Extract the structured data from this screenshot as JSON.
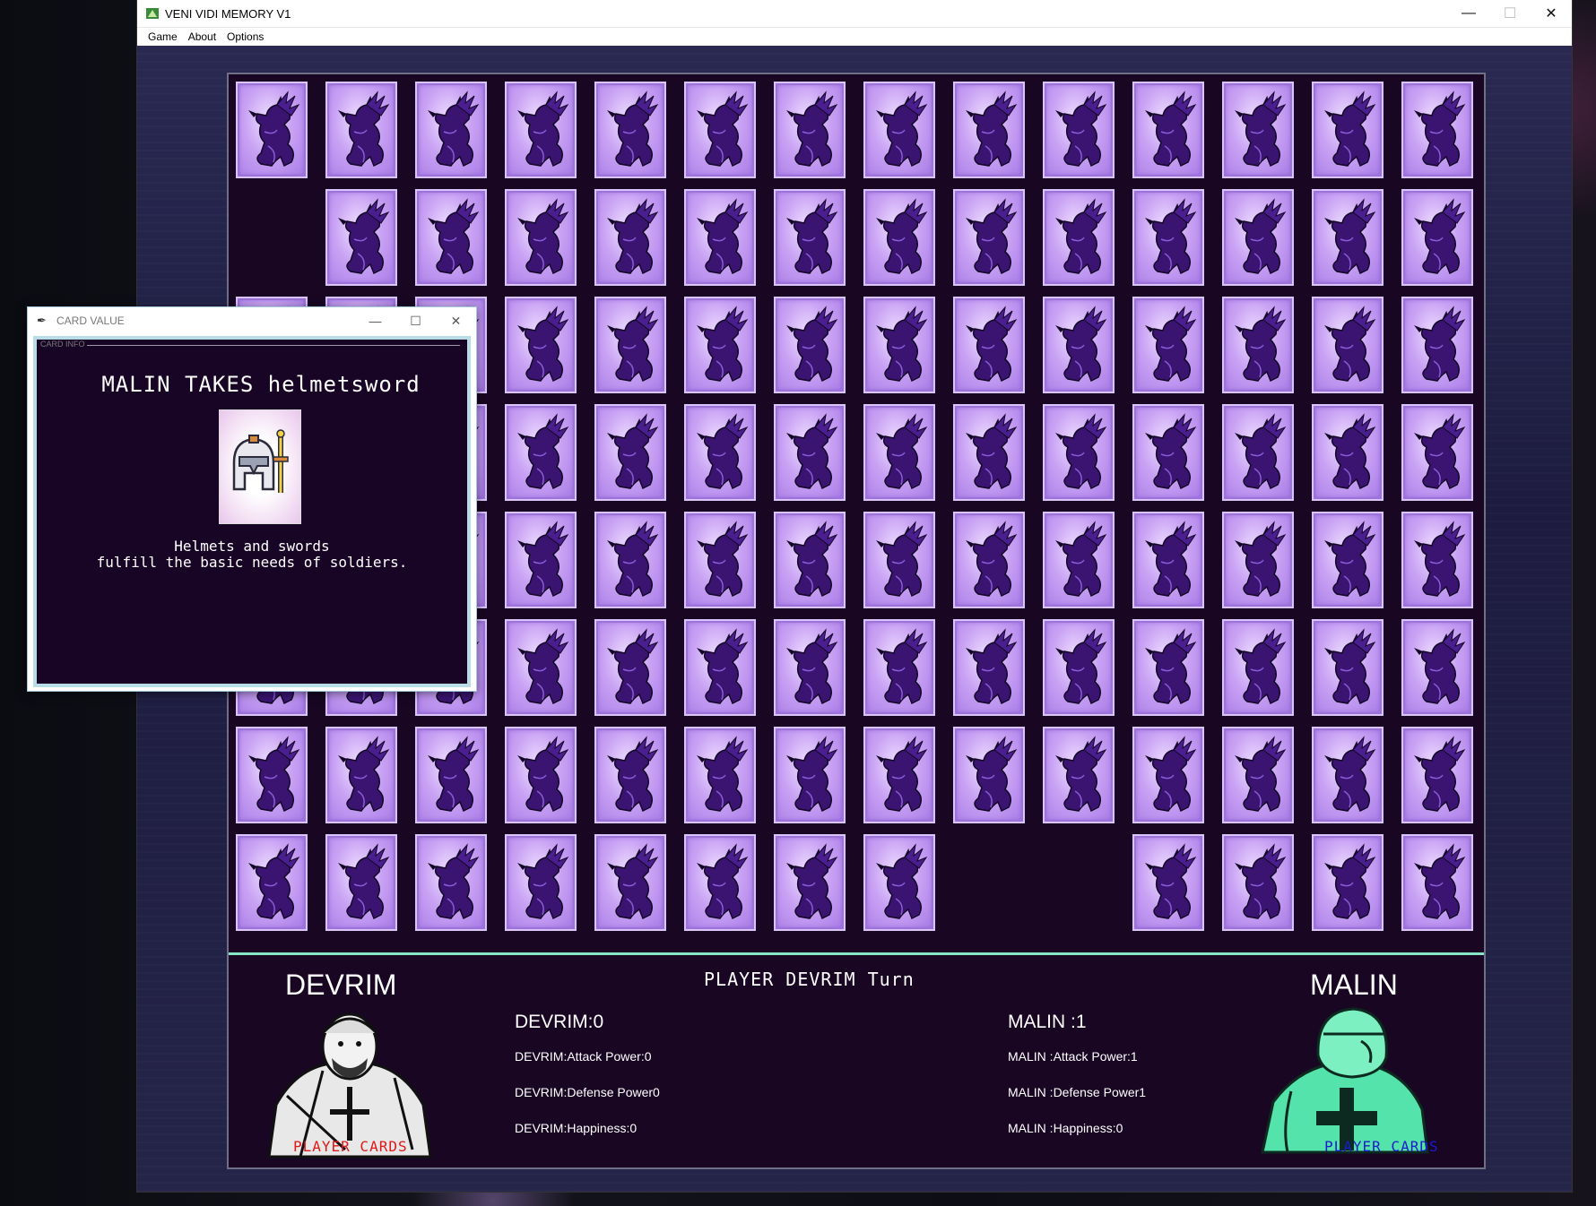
{
  "window": {
    "title": "VENI VIDI MEMORY V1",
    "controls": {
      "minimize": "—",
      "maximize": "☐",
      "close": "✕"
    }
  },
  "menu": {
    "items": [
      "Game",
      "About",
      "Options"
    ]
  },
  "board": {
    "rows": [
      [
        1,
        1,
        1,
        1,
        1,
        1,
        1,
        1,
        1,
        1,
        1,
        1,
        1,
        1
      ],
      [
        0,
        1,
        1,
        1,
        1,
        1,
        1,
        1,
        1,
        1,
        1,
        1,
        1,
        1
      ],
      [
        1,
        1,
        1,
        1,
        1,
        1,
        1,
        1,
        1,
        1,
        1,
        1,
        1,
        1
      ],
      [
        1,
        1,
        1,
        1,
        1,
        1,
        1,
        1,
        1,
        1,
        1,
        1,
        1,
        1
      ],
      [
        1,
        1,
        1,
        1,
        1,
        1,
        1,
        1,
        1,
        1,
        1,
        1,
        1,
        1
      ],
      [
        1,
        1,
        1,
        1,
        1,
        1,
        1,
        1,
        1,
        1,
        1,
        1,
        1,
        1
      ],
      [
        1,
        1,
        1,
        1,
        1,
        1,
        1,
        1,
        1,
        1,
        1,
        1,
        1,
        1
      ],
      [
        1,
        1,
        1,
        1,
        1,
        1,
        1,
        1,
        0,
        0,
        1,
        1,
        1,
        1
      ]
    ],
    "card_back_icon": "dragon-icon"
  },
  "info": {
    "turn": "PLAYER DEVRIM Turn",
    "player_left": {
      "name": "DEVRIM",
      "score": "DEVRIM:0",
      "attack": "DEVRIM:Attack Power:0",
      "defense": "DEVRIM:Defense Power0",
      "happiness": "DEVRIM:Happiness:0",
      "cards_label": "PLAYER CARDS",
      "label_color": "#e01818"
    },
    "player_right": {
      "name": "MALIN",
      "score": "MALIN :1",
      "attack": "MALIN :Attack Power:1",
      "defense": "MALIN :Defense Power1",
      "happiness": "MALIN :Happiness:0",
      "cards_label": "PLAYER CARDS",
      "label_color": "#1b1bcf"
    }
  },
  "dialog": {
    "title": "CARD VALUE",
    "frame_tag": "CARD INFO",
    "heading": "MALIN  TAKES helmetsword",
    "card_icon": "helmet-sword-icon",
    "description": "Helmets and swords\nfulfill the basic needs of soldiers."
  },
  "colors": {
    "board_bg": "#180623",
    "divider": "#86e4c7",
    "card_purple": "#c9a2f4",
    "dragon": "#3a1470"
  }
}
